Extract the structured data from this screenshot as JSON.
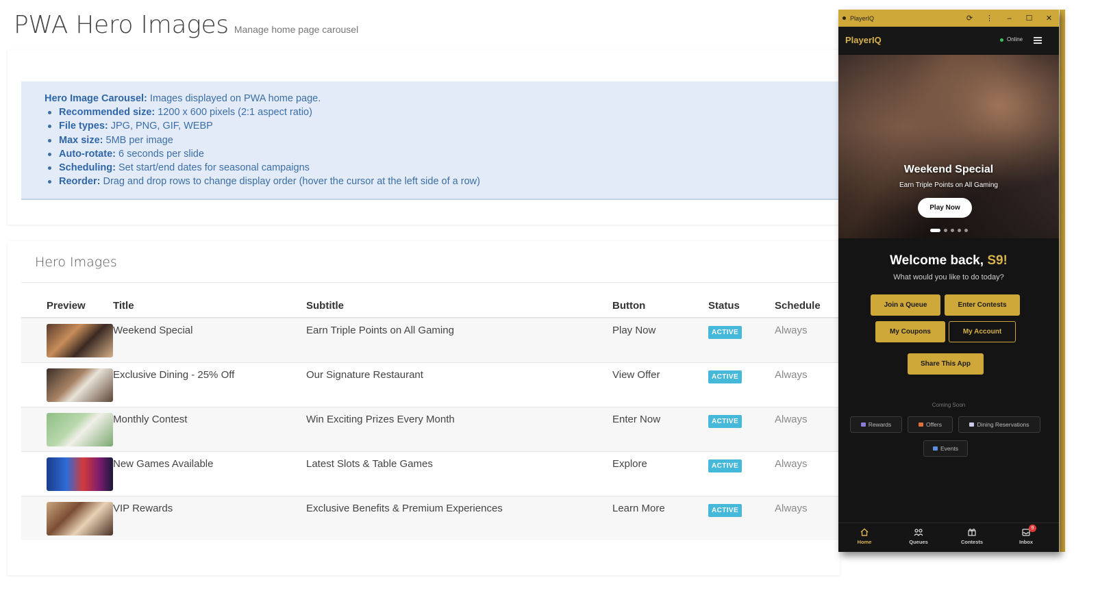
{
  "page": {
    "title": "PWA Hero Images",
    "subtitle": "Manage home page carousel"
  },
  "info": {
    "lead_bold": "Hero Image Carousel:",
    "lead_text": " Images displayed on PWA home page.",
    "items": [
      {
        "label": "Recommended size:",
        "text": " 1200 x 600 pixels (2:1 aspect ratio)"
      },
      {
        "label": "File types:",
        "text": " JPG, PNG, GIF, WEBP"
      },
      {
        "label": "Max size:",
        "text": " 5MB per image"
      },
      {
        "label": "Auto-rotate:",
        "text": " 6 seconds per slide"
      },
      {
        "label": "Scheduling:",
        "text": " Set start/end dates for seasonal campaigns"
      },
      {
        "label": "Reorder:",
        "text": " Drag and drop rows to change display order (hover the cursor at the left side of a row)"
      }
    ]
  },
  "table": {
    "section_title": "Hero Images",
    "columns": [
      "Preview",
      "Title",
      "Subtitle",
      "Button",
      "Status",
      "Schedule"
    ],
    "rows": [
      {
        "title": "Weekend Special",
        "subtitle": "Earn Triple Points on All Gaming",
        "button": "Play Now",
        "status": "ACTIVE",
        "schedule": "Always"
      },
      {
        "title": "Exclusive Dining - 25% Off",
        "subtitle": "Our Signature Restaurant",
        "button": "View Offer",
        "status": "ACTIVE",
        "schedule": "Always"
      },
      {
        "title": "Monthly Contest",
        "subtitle": "Win Exciting Prizes Every Month",
        "button": "Enter Now",
        "status": "ACTIVE",
        "schedule": "Always"
      },
      {
        "title": "New Games Available",
        "subtitle": "Latest Slots & Table Games",
        "button": "Explore",
        "status": "ACTIVE",
        "schedule": "Always"
      },
      {
        "title": "VIP Rewards",
        "subtitle": "Exclusive Benefits & Premium Experiences",
        "button": "Learn More",
        "status": "ACTIVE",
        "schedule": "Always"
      }
    ]
  },
  "app": {
    "window_title": "PlayerIQ",
    "window_controls": [
      "⟳",
      "⋮",
      "–",
      "☐",
      "✕"
    ],
    "brand": "PlayerIQ",
    "online_label": "Online",
    "hero": {
      "title": "Weekend Special",
      "subtitle": "Earn Triple Points on All Gaming",
      "button": "Play Now",
      "slide_count": 5,
      "active_slide": 1
    },
    "welcome_prefix": "Welcome back, ",
    "welcome_name": "S9!",
    "welcome_sub": "What would you like to do today?",
    "actions": {
      "join_queue": "Join a Queue",
      "enter_contests": "Enter Contests",
      "my_coupons": "My Coupons",
      "my_account": "My Account",
      "share": "Share This App"
    },
    "coming_soon": "Coming Soon",
    "chips": {
      "rewards": "Rewards",
      "offers": "Offers",
      "dining": "Dining Reservations",
      "events": "Events"
    },
    "nav": {
      "home": "Home",
      "queues": "Queues",
      "contests": "Contests",
      "inbox": "Inbox",
      "inbox_count": "9"
    },
    "colors": {
      "accent": "#cfa83a",
      "badge": "#46b8da",
      "online": "#3fbf58"
    }
  }
}
